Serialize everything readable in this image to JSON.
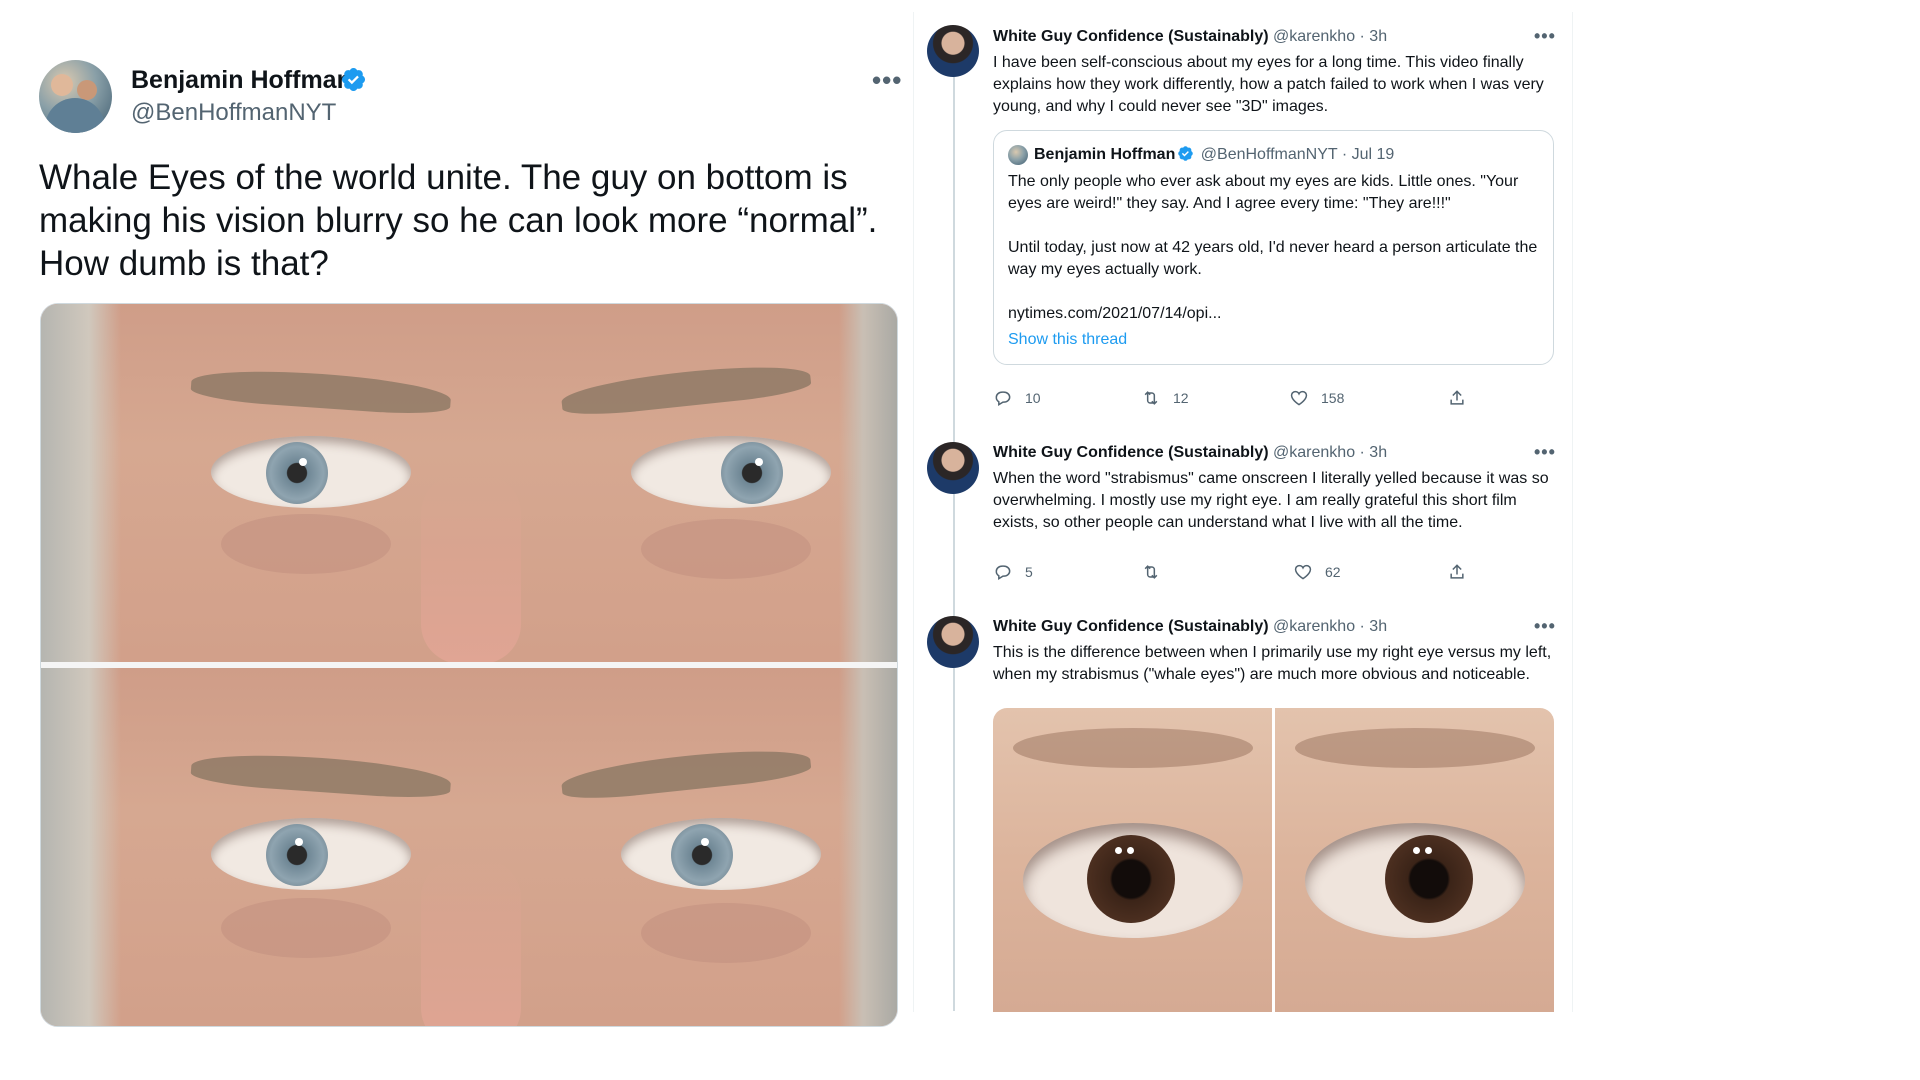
{
  "main_tweet": {
    "author_name": "Benjamin Hoffman",
    "author_handle": "@BenHoffmanNYT",
    "text": "Whale Eyes of the world unite. The guy on bottom is making his vision blurry so he can look more “normal”. How dumb is that?",
    "more_label": "•••"
  },
  "thread": [
    {
      "author_name": "White Guy Confidence (Sustainably)",
      "meta": " @karenkho · 3h",
      "text": "I have been self-conscious about my eyes for a long time. This video finally explains how they work differently, how a patch failed to work when I was very young, and why I could never see \"3D\" images.",
      "quote": {
        "author_name": "Benjamin Hoffman",
        "meta": " @BenHoffmanNYT · Jul 19",
        "text_1": "The only people who ever ask about my eyes are kids. Little ones. \"Your eyes are weird!\" they say. And I agree every time: \"They are!!!\"",
        "text_2": "Until today, just now at 42 years old, I'd never heard a person articulate the way my eyes actually work.",
        "link": "nytimes.com/2021/07/14/opi...",
        "show_thread": "Show this thread"
      },
      "replies": "10",
      "retweets": "12",
      "likes": "158"
    },
    {
      "author_name": "White Guy Confidence (Sustainably)",
      "meta": " @karenkho · 3h",
      "text": "When the word \"strabismus\" came onscreen I literally yelled because it was so overwhelming. I mostly use my right eye. I am really grateful this short film exists, so other people can understand what I live with all the time.",
      "replies": "5",
      "retweets": "",
      "likes": "62"
    },
    {
      "author_name": "White Guy Confidence (Sustainably)",
      "meta": " @karenkho · 3h",
      "text": "This is the difference between when I primarily use my right eye versus my left, when my strabismus (\"whale eyes\") are much more obvious and noticeable."
    }
  ],
  "colors": {
    "verified": "#1d9bf0",
    "link": "#1d9bf0",
    "secondary_text": "#536471",
    "border": "#cfd9de"
  },
  "icons": [
    "verified-badge-icon",
    "more-options-icon",
    "reply-icon",
    "retweet-icon",
    "like-icon",
    "share-icon"
  ]
}
